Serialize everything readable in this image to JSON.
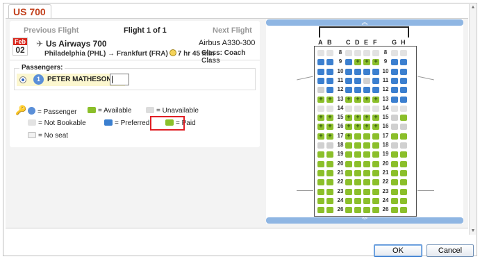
{
  "tab": {
    "title": "US 700"
  },
  "flight": {
    "prev_label": "Previous Flight",
    "counter": "Flight 1 of 1",
    "next_label": "Next Flight",
    "date_month": "Feb",
    "date_day": "02",
    "airline": "Us Airways 700",
    "aircraft": "Airbus A330-300",
    "route": "Philadelphia (PHL) → Frankfurt (FRA)",
    "duration": "7 hr 45 min",
    "class": "Class: Coach Class"
  },
  "passengers": {
    "label": "Passengers:",
    "list": [
      {
        "number": "1",
        "name": "PETER MATHESON",
        "seat": ""
      }
    ]
  },
  "legend": {
    "passenger": "= Passenger",
    "available": "= Available",
    "unavailable": "= Unavailable",
    "not_bookable": "= Not Bookable",
    "preferred": "= Preferred",
    "paid": "= Paid",
    "no_seat": "= No seat"
  },
  "seatmap": {
    "columns": [
      "A",
      "B",
      "C",
      "D",
      "E",
      "F",
      "G",
      "H"
    ],
    "rows": [
      {
        "num": "8",
        "seats": [
          "na",
          "na",
          "na",
          "na",
          "na",
          "na",
          "na",
          "na"
        ]
      },
      {
        "num": "9",
        "seats": [
          "pr",
          "pr",
          "pr",
          "pd",
          "pd",
          "pd",
          "pr",
          "pr"
        ]
      },
      {
        "num": "10",
        "seats": [
          "pr",
          "pr",
          "pr",
          "pr",
          "pr",
          "pr",
          "pr",
          "pr"
        ]
      },
      {
        "num": "11",
        "seats": [
          "pr",
          "pr",
          "pr",
          "pr",
          "un",
          "pr",
          "pr",
          "pr"
        ]
      },
      {
        "num": "12",
        "seats": [
          "un",
          "pr",
          "pr",
          "pr",
          "pr",
          "pr",
          "pr",
          "pr"
        ]
      },
      {
        "num": "13",
        "seats": [
          "pd",
          "pd",
          "pd",
          "pd",
          "pd",
          "pd",
          "pr",
          "pr"
        ]
      },
      {
        "num": "14",
        "seats": [
          "na",
          "na",
          "na",
          "na",
          "na",
          "na",
          "na",
          "na"
        ]
      },
      {
        "num": "15",
        "seats": [
          "pd",
          "pd",
          "pd",
          "pd",
          "pd",
          "pd",
          "un",
          "av"
        ]
      },
      {
        "num": "16",
        "seats": [
          "pd",
          "pd",
          "pd",
          "pd",
          "pd",
          "pd",
          "un",
          "un"
        ]
      },
      {
        "num": "17",
        "seats": [
          "pd",
          "pd",
          "pd",
          "av",
          "av",
          "av",
          "av",
          "av"
        ]
      },
      {
        "num": "18",
        "seats": [
          "un",
          "un",
          "av",
          "av",
          "av",
          "av",
          "un",
          "un"
        ]
      },
      {
        "num": "19",
        "seats": [
          "av",
          "av",
          "av",
          "av",
          "av",
          "av",
          "av",
          "av"
        ]
      },
      {
        "num": "20",
        "seats": [
          "av",
          "av",
          "av",
          "av",
          "av",
          "av",
          "av",
          "av"
        ]
      },
      {
        "num": "21",
        "seats": [
          "av",
          "av",
          "av",
          "av",
          "av",
          "av",
          "av",
          "av"
        ]
      },
      {
        "num": "22",
        "seats": [
          "av",
          "av",
          "av",
          "av",
          "av",
          "av",
          "av",
          "av"
        ]
      },
      {
        "num": "23",
        "seats": [
          "av",
          "av",
          "av",
          "av",
          "av",
          "av",
          "av",
          "av"
        ]
      },
      {
        "num": "24",
        "seats": [
          "av",
          "av",
          "av",
          "av",
          "av",
          "av",
          "av",
          "av"
        ]
      },
      {
        "num": "26",
        "seats": [
          "av",
          "av",
          "av",
          "av",
          "av",
          "av",
          "av",
          "av"
        ]
      }
    ]
  },
  "buttons": {
    "ok": "OK",
    "cancel": "Cancel"
  },
  "colors": {
    "accent": "#c2411d",
    "available": "#8bbf2a",
    "preferred": "#3b7fcf",
    "highlight": "#e01e24"
  }
}
